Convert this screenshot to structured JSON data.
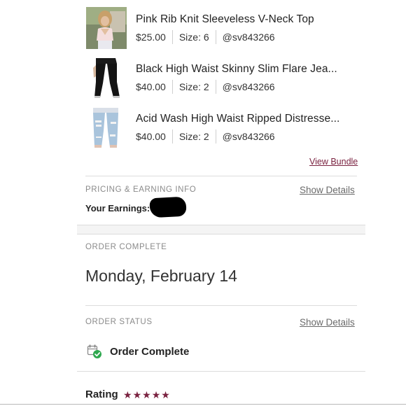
{
  "items": [
    {
      "title": "Pink Rib Knit Sleeveless V-Neck Top",
      "price": "$25.00",
      "size": "Size: 6",
      "seller": "@sv843266",
      "thumb_icon": "pink-top-photo"
    },
    {
      "title": "Black High Waist Skinny Slim Flare Jea...",
      "price": "$40.00",
      "size": "Size: 2",
      "seller": "@sv843266",
      "thumb_icon": "black-jeans-photo"
    },
    {
      "title": "Acid Wash High Waist Ripped Distresse...",
      "price": "$40.00",
      "size": "Size: 2",
      "seller": "@sv843266",
      "thumb_icon": "ripped-jeans-photo"
    }
  ],
  "bundle": {
    "view_label": "View Bundle"
  },
  "pricing": {
    "section_label": "PRICING & EARNING INFO",
    "show_details": "Show Details",
    "earnings_label": "Your Earnings:"
  },
  "order_complete": {
    "section_label": "ORDER COMPLETE",
    "date": "Monday, February 14"
  },
  "order_status": {
    "section_label": "ORDER STATUS",
    "show_details": "Show Details",
    "status_text": "Order Complete",
    "status_icon": "order-complete-check-icon"
  },
  "rating": {
    "label": "Rating",
    "stars": 5,
    "max_stars": 5,
    "star_char": "★"
  },
  "colors": {
    "accent": "#7a2240",
    "check_green": "#2fa84f",
    "divider": "#dcdcdc",
    "muted_text": "#8a8a8a"
  }
}
